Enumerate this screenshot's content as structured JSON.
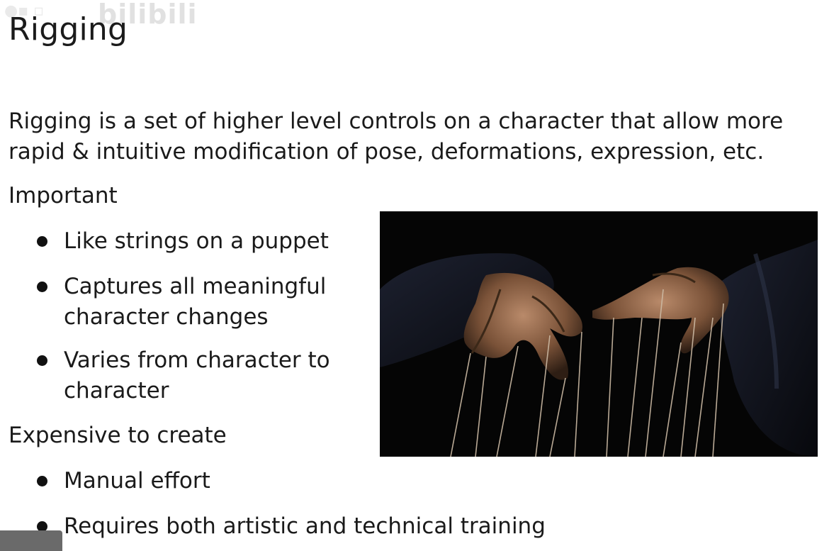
{
  "slide": {
    "title": "Rigging",
    "watermark_text": "bilibili",
    "intro": "Rigging is a set of higher level controls on a character that allow more rapid & intuitive modification of pose, deformations, expression, etc.",
    "sections": [
      {
        "heading": "Important",
        "bullets": [
          "Like strings on a puppet",
          "Captures all meaningful character changes",
          "Varies from character to character"
        ]
      },
      {
        "heading": "Expensive to create",
        "bullets": [
          "Manual effort",
          "Requires both artistic and technical training"
        ]
      }
    ]
  },
  "image": {
    "subject": "hands-controlling-marionette-strings"
  },
  "colors": {
    "text": "#1a1a1a",
    "background": "#ffffff",
    "image_background": "#050505"
  }
}
